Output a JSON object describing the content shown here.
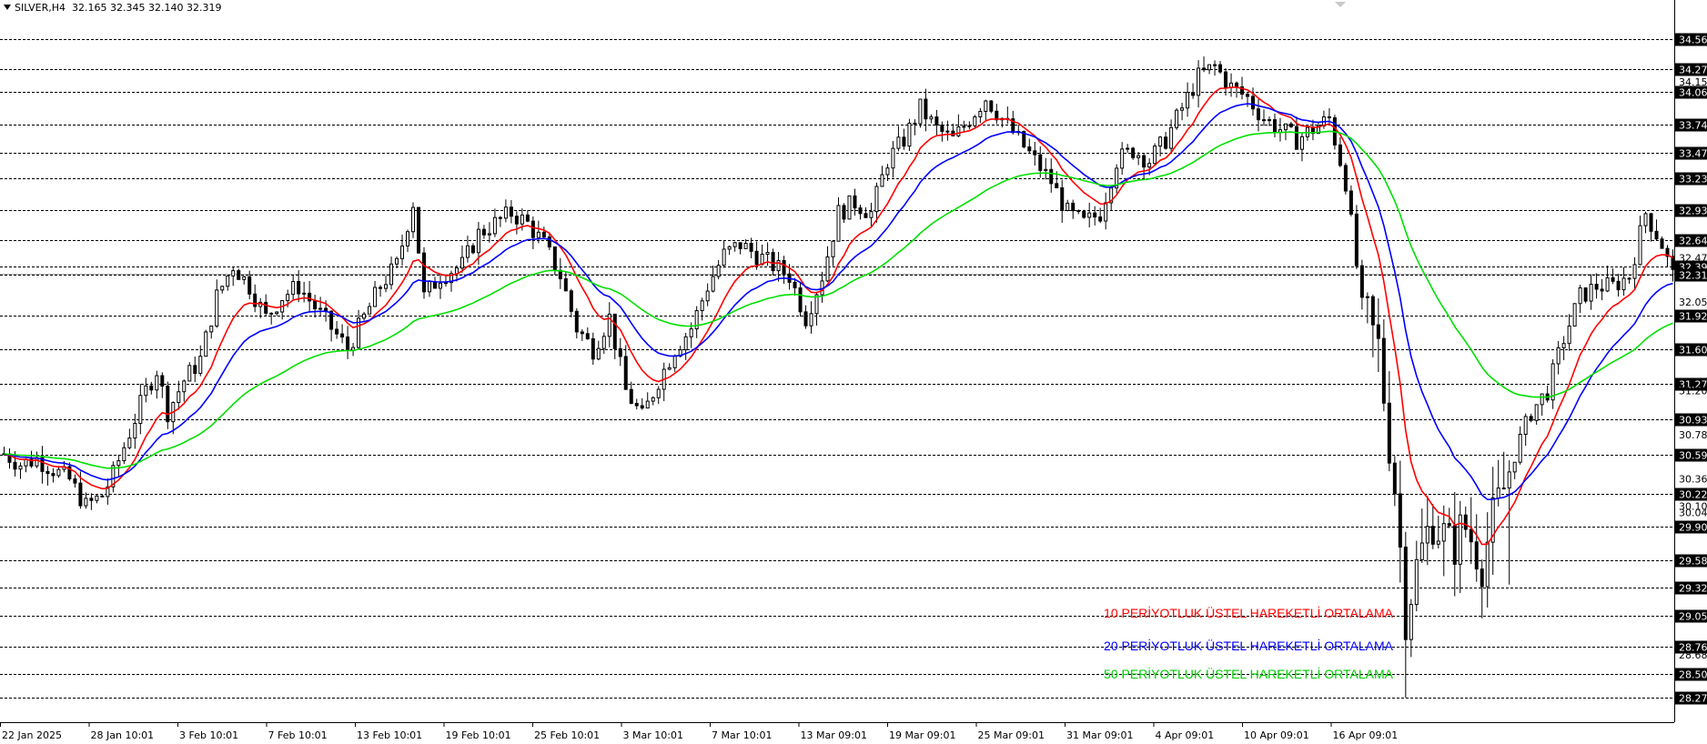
{
  "header": {
    "symbol": "SILVER,H4",
    "ohlc": "32.165 32.345 32.140 32.319"
  },
  "colors": {
    "ema10": "#ff0000",
    "ema20": "#0000ff",
    "ema50": "#00e000",
    "candles": "#000000",
    "levels": "#000000",
    "price_label_bg": "#000000"
  },
  "legend": [
    {
      "text": "10 PERİYOTLUK ÜSTEL HAREKETLİ ORTALAMA",
      "color": "#ff0000"
    },
    {
      "text": "20 PERİYOTLUK ÜSTEL HAREKETLİ ORTALAMA",
      "color": "#0000ff"
    },
    {
      "text": "50 PERİYOTLUK ÜSTEL HAREKETLİ ORTALAMA",
      "color": "#00cc00"
    }
  ],
  "chart_data": {
    "type": "candlestick",
    "ylim": [
      28.0,
      34.75
    ],
    "x_tick_labels": [
      "22 Jan 2025",
      "28 Jan 10:01",
      "3 Feb 10:01",
      "7 Feb 10:01",
      "13 Feb 10:01",
      "19 Feb 10:01",
      "25 Feb 10:01",
      "3 Mar 10:01",
      "7 Mar 10:01",
      "13 Mar 09:01",
      "19 Mar 09:01",
      "25 Mar 09:01",
      "31 Mar 09:01",
      "4 Apr 09:01",
      "10 Apr 09:01",
      "16 Apr 09:01"
    ],
    "y_tick_labels": [
      "34.15",
      "32.47",
      "32.05",
      "31.20",
      "30.78",
      "30.36",
      "30.04",
      "30.10",
      "28.68"
    ],
    "horizontal_levels": [
      "34.56",
      "34.27",
      "34.06",
      "33.74",
      "33.47",
      "33.23",
      "32.93",
      "32.64",
      "32.39",
      "32.31",
      "31.92",
      "31.60",
      "31.27",
      "30.93",
      "30.59",
      "30.22",
      "29.90",
      "29.58",
      "29.32",
      "29.05",
      "28.76",
      "28.50",
      "28.27"
    ],
    "current_price": 32.319,
    "price_path": [
      [
        0,
        30.6
      ],
      [
        3,
        30.5
      ],
      [
        6,
        30.55
      ],
      [
        9,
        30.45
      ],
      [
        12,
        30.35
      ],
      [
        15,
        30.1
      ],
      [
        18,
        30.2
      ],
      [
        20,
        30.4
      ],
      [
        23,
        30.8
      ],
      [
        26,
        31.2
      ],
      [
        28,
        31.4
      ],
      [
        30,
        31.0
      ],
      [
        33,
        31.3
      ],
      [
        36,
        31.5
      ],
      [
        39,
        32.1
      ],
      [
        42,
        32.4
      ],
      [
        45,
        32.2
      ],
      [
        48,
        31.9
      ],
      [
        51,
        32.1
      ],
      [
        54,
        32.2
      ],
      [
        57,
        32.0
      ],
      [
        60,
        31.8
      ],
      [
        63,
        31.6
      ],
      [
        66,
        31.9
      ],
      [
        69,
        32.2
      ],
      [
        72,
        32.4
      ],
      [
        75,
        33.0
      ],
      [
        77,
        32.1
      ],
      [
        80,
        32.3
      ],
      [
        84,
        32.4
      ],
      [
        87,
        32.7
      ],
      [
        90,
        32.8
      ],
      [
        93,
        32.9
      ],
      [
        96,
        32.8
      ],
      [
        99,
        32.6
      ],
      [
        102,
        32.3
      ],
      [
        105,
        31.8
      ],
      [
        108,
        31.6
      ],
      [
        111,
        31.9
      ],
      [
        114,
        31.2
      ],
      [
        117,
        30.95
      ],
      [
        120,
        31.3
      ],
      [
        123,
        31.6
      ],
      [
        126,
        31.8
      ],
      [
        129,
        32.2
      ],
      [
        132,
        32.5
      ],
      [
        135,
        32.6
      ],
      [
        138,
        32.5
      ],
      [
        141,
        32.4
      ],
      [
        144,
        32.3
      ],
      [
        147,
        31.9
      ],
      [
        150,
        32.3
      ],
      [
        153,
        32.9
      ],
      [
        156,
        33.0
      ],
      [
        159,
        32.9
      ],
      [
        162,
        33.4
      ],
      [
        165,
        33.6
      ],
      [
        168,
        33.9
      ],
      [
        171,
        33.7
      ],
      [
        174,
        33.6
      ],
      [
        177,
        33.8
      ],
      [
        180,
        34.0
      ],
      [
        183,
        33.8
      ],
      [
        186,
        33.6
      ],
      [
        189,
        33.4
      ],
      [
        192,
        33.2
      ],
      [
        195,
        32.9
      ],
      [
        198,
        32.8
      ],
      [
        201,
        32.9
      ],
      [
        204,
        33.4
      ],
      [
        207,
        33.5
      ],
      [
        210,
        33.4
      ],
      [
        213,
        33.6
      ],
      [
        216,
        33.9
      ],
      [
        219,
        34.2
      ],
      [
        222,
        34.3
      ],
      [
        225,
        34.1
      ],
      [
        228,
        34.0
      ],
      [
        231,
        33.8
      ],
      [
        234,
        33.7
      ],
      [
        237,
        33.6
      ],
      [
        240,
        33.7
      ],
      [
        243,
        33.8
      ],
      [
        246,
        33.2
      ],
      [
        249,
        32.0
      ],
      [
        252,
        31.6
      ],
      [
        255,
        30.3
      ],
      [
        257,
        29.1
      ],
      [
        259,
        29.5
      ],
      [
        262,
        30.0
      ],
      [
        265,
        29.7
      ],
      [
        268,
        29.9
      ],
      [
        271,
        29.6
      ],
      [
        274,
        30.1
      ],
      [
        277,
        30.6
      ],
      [
        280,
        31.0
      ],
      [
        283,
        31.2
      ],
      [
        286,
        31.7
      ],
      [
        289,
        32.1
      ],
      [
        292,
        32.2
      ],
      [
        295,
        32.2
      ],
      [
        298,
        32.3
      ],
      [
        301,
        32.9
      ],
      [
        304,
        32.6
      ],
      [
        306,
        32.3
      ]
    ]
  }
}
